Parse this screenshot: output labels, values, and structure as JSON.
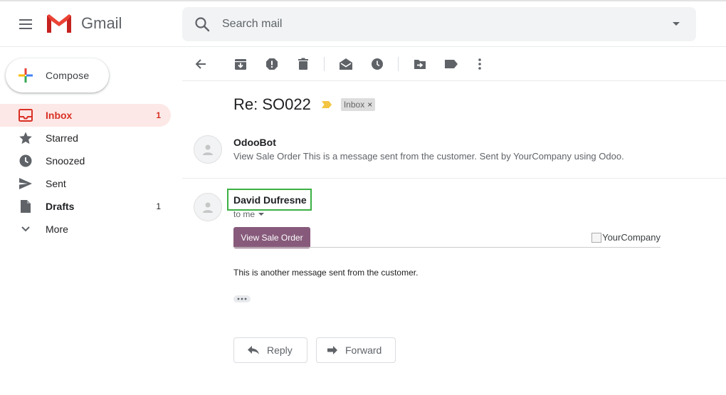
{
  "header": {
    "app_name": "Gmail",
    "search_placeholder": "Search mail"
  },
  "sidebar": {
    "compose_label": "Compose",
    "items": [
      {
        "label": "Inbox",
        "icon": "inbox-icon",
        "count": "1",
        "active": true
      },
      {
        "label": "Starred",
        "icon": "star-icon",
        "count": ""
      },
      {
        "label": "Snoozed",
        "icon": "clock-icon",
        "count": ""
      },
      {
        "label": "Sent",
        "icon": "send-icon",
        "count": ""
      },
      {
        "label": "Drafts",
        "icon": "draft-icon",
        "count": "1"
      },
      {
        "label": "More",
        "icon": "chevron-down-icon",
        "count": ""
      }
    ]
  },
  "thread": {
    "subject": "Re: SO022",
    "label_chip": "Inbox",
    "chip_close": "×",
    "messages": [
      {
        "sender": "OdooBot",
        "snippet": "View Sale Order This is a message sent from the customer. Sent by YourCompany using Odoo."
      },
      {
        "sender": "David Dufresne",
        "recipient": "to me",
        "button_label": "View Sale Order",
        "company_logo_alt": "YourCompany",
        "body": "This is another message sent from the customer."
      }
    ]
  },
  "actions": {
    "reply_label": "Reply",
    "forward_label": "Forward"
  },
  "colors": {
    "accent_red": "#d93025",
    "active_bg": "#fce8e6",
    "odoo_purple": "#875a7b",
    "highlight_green": "#3cb043",
    "important_yellow": "#f4c542"
  }
}
